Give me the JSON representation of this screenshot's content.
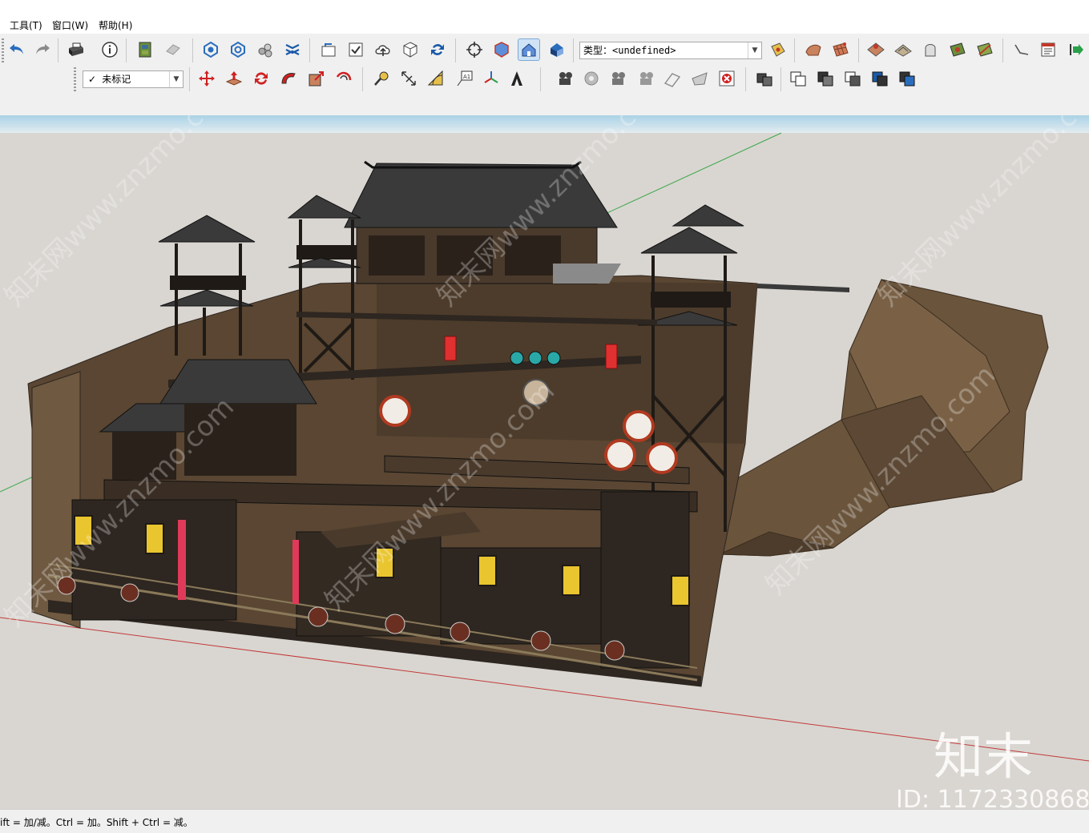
{
  "menu": {
    "items": [
      {
        "label": "工具(T)"
      },
      {
        "label": "窗口(W)"
      },
      {
        "label": "帮助(H)"
      }
    ]
  },
  "toolbar": {
    "row1": [
      {
        "icon": "undo-icon"
      },
      {
        "icon": "redo-icon"
      },
      {
        "icon": "print-icon"
      },
      {
        "icon": "model-info-icon"
      },
      {
        "icon": "components-icon"
      },
      {
        "icon": "eraser-icon"
      },
      {
        "icon": "component-options-icon"
      },
      {
        "icon": "component-attributes-icon"
      },
      {
        "icon": "solid-inspector-icon"
      },
      {
        "icon": "outer-shell-icon"
      },
      {
        "icon": "open-file-icon"
      },
      {
        "icon": "checkbox-icon"
      },
      {
        "icon": "cloud-upload-icon"
      },
      {
        "icon": "package-icon"
      },
      {
        "icon": "refresh-icon"
      },
      {
        "icon": "orbit-target-icon"
      },
      {
        "icon": "section-cube-icon"
      },
      {
        "icon": "house-view-icon"
      },
      {
        "icon": "house-iso-icon"
      },
      {
        "icon": "sandbox-drape-icon"
      },
      {
        "icon": "texture-paint-icon"
      },
      {
        "icon": "grid-sheet-icon"
      },
      {
        "icon": "stamp-icon"
      },
      {
        "icon": "smoove-icon"
      },
      {
        "icon": "contour-icon"
      },
      {
        "icon": "mesh-plane-icon"
      },
      {
        "icon": "flip-edge-icon"
      },
      {
        "icon": "pencil-line-icon"
      },
      {
        "icon": "report-icon"
      },
      {
        "icon": "export-icon"
      }
    ],
    "type_dropdown": {
      "value": "类型：<undefined>"
    },
    "tag_dropdown": {
      "value": "未标记"
    },
    "row2": [
      {
        "icon": "move-arrows-icon"
      },
      {
        "icon": "push-pull-icon"
      },
      {
        "icon": "rotate-icon"
      },
      {
        "icon": "follow-me-icon"
      },
      {
        "icon": "scale-icon"
      },
      {
        "icon": "offset-icon"
      },
      {
        "icon": "tape-measure-icon"
      },
      {
        "icon": "dimension-icon"
      },
      {
        "icon": "protractor-icon"
      },
      {
        "icon": "text-label-icon"
      },
      {
        "icon": "axes-icon"
      },
      {
        "icon": "3d-text-icon"
      },
      {
        "icon": "camera-position-icon"
      },
      {
        "icon": "look-around-icon"
      },
      {
        "icon": "walk-icon"
      },
      {
        "icon": "camera-icon"
      },
      {
        "icon": "section-plane-icon"
      },
      {
        "icon": "section-fill-icon"
      },
      {
        "icon": "section-display-icon"
      },
      {
        "icon": "boxes-icon"
      },
      {
        "icon": "union-icon"
      },
      {
        "icon": "subtract-icon"
      },
      {
        "icon": "intersect-icon"
      },
      {
        "icon": "trim-icon"
      },
      {
        "icon": "split-icon"
      }
    ]
  },
  "watermarks": {
    "site": "知末网www.znzmo.com",
    "brand": "知末",
    "id_text": "ID: 1172330868"
  },
  "statusbar": {
    "text": "ift = 加/减。Ctrl = 加。Shift + Ctrl = 减。"
  },
  "colors": {
    "sky": "#dfe9ef",
    "ground": "#d9d6d1",
    "terrain": "#5a4632",
    "wood_dark": "#2e2620",
    "roof": "#3a3a3a",
    "banner_yellow": "#e9c52f",
    "lantern_red": "#e03030",
    "accent_blue": "#2a6dbd"
  }
}
